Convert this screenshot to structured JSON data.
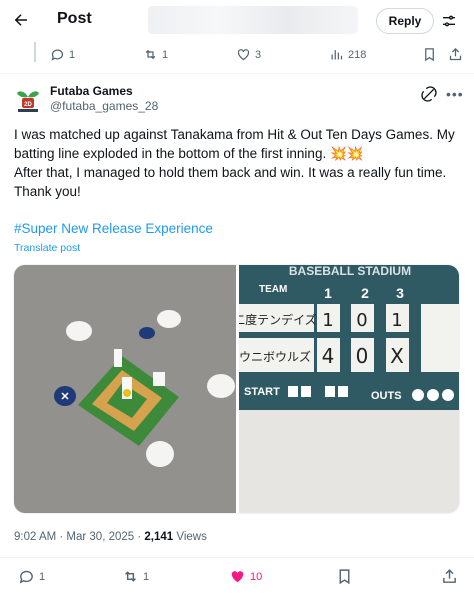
{
  "header": {
    "title": "Post",
    "reply_label": "Reply"
  },
  "parent_actions": {
    "replies": "1",
    "reposts": "1",
    "likes": "3",
    "views": "218"
  },
  "author": {
    "name": "Futaba Games",
    "handle": "@futaba_games_28"
  },
  "post": {
    "line1": "I was matched up against Tanakama from Hit & Out Ten Days Games. My batting line exploded in the bottom of the first inning. 💥💥",
    "line2": "After that, I managed to hold them back and win. It was a really fun time. Thank you!",
    "hashtag": "#Super New Release Experience",
    "translate": "Translate post"
  },
  "scoreboard": {
    "header_team": "TEAM",
    "innings": [
      "1",
      "2",
      "3"
    ],
    "team1": "二度テンデイズ",
    "team1_scores": [
      "1",
      "0",
      "1"
    ],
    "team2": "ウニボウルズ",
    "team2_scores": [
      "4",
      "0",
      "X"
    ],
    "start_label": "START",
    "outs_label": "OUTS",
    "banner": "BASEBALL STADIUM"
  },
  "meta": {
    "time": "9:02 AM · Mar 30, 2025 · ",
    "views_count": "2,141",
    "views_label": " Views"
  },
  "actions": {
    "replies": "1",
    "reposts": "1",
    "likes": "10"
  },
  "colors": {
    "accent": "#1d9bf0",
    "like": "#f91880",
    "muted": "#536471"
  }
}
